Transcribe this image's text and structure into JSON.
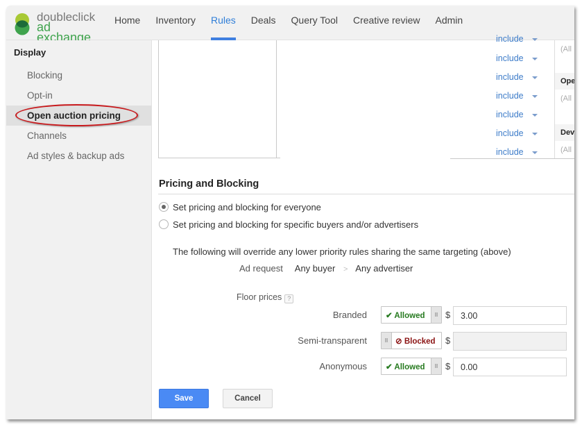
{
  "app": {
    "logo_line1": "doubleclick",
    "logo_line2": "ad exchange",
    "brand_colors": {
      "top_circle": "#a8c935",
      "bottom_circle": "#3fa34d",
      "overlap": "#1d6b3a"
    }
  },
  "nav": {
    "items": [
      {
        "label": "Home",
        "active": false
      },
      {
        "label": "Inventory",
        "active": false
      },
      {
        "label": "Rules",
        "active": true
      },
      {
        "label": "Deals",
        "active": false
      },
      {
        "label": "Query Tool",
        "active": false
      },
      {
        "label": "Creative review",
        "active": false
      },
      {
        "label": "Admin",
        "active": false
      }
    ],
    "active_color": "#3f7fe0"
  },
  "sidebar": {
    "title": "Display",
    "items": [
      {
        "label": "Blocking",
        "active": false
      },
      {
        "label": "Opt-in",
        "active": false
      },
      {
        "label": "Open auction pricing",
        "active": true
      },
      {
        "label": "Channels",
        "active": false
      },
      {
        "label": "Ad styles & backup ads",
        "active": false
      }
    ],
    "annotation_color": "#c8191c"
  },
  "targeting_list": {
    "include_rows": [
      "include",
      "include",
      "include",
      "include",
      "include",
      "include",
      "include"
    ],
    "side_column": [
      {
        "type": "value",
        "text": "(All"
      },
      {
        "type": "header",
        "text": "Ope"
      },
      {
        "type": "value",
        "text": "(All"
      },
      {
        "type": "header",
        "text": "Dev"
      },
      {
        "type": "value",
        "text": "(All"
      }
    ]
  },
  "pricing": {
    "title": "Pricing and Blocking",
    "options": [
      {
        "label": "Set pricing and blocking for everyone",
        "checked": true
      },
      {
        "label": "Set pricing and blocking for specific buyers and/or advertisers",
        "checked": false
      }
    ],
    "override_note": "The following will override any lower priority rules sharing the same targeting (above)",
    "breadcrumb": {
      "label": "Ad request",
      "buyer": "Any buyer",
      "separator": ">",
      "advertiser": "Any advertiser"
    },
    "floor_prices_label": "Floor prices",
    "help_glyph": "?",
    "currency": "$",
    "rows": [
      {
        "label": "Branded",
        "state": "Allowed",
        "value": "3.00",
        "disabled": false
      },
      {
        "label": "Semi-transparent",
        "state": "Blocked",
        "value": "",
        "disabled": true
      },
      {
        "label": "Anonymous",
        "state": "Allowed",
        "value": "0.00",
        "disabled": false
      }
    ],
    "grip_glyph": "II",
    "allowed_icon": "✔",
    "blocked_icon": "⊘"
  },
  "actions": {
    "save": "Save",
    "cancel": "Cancel",
    "save_color": "#4a8af4"
  }
}
